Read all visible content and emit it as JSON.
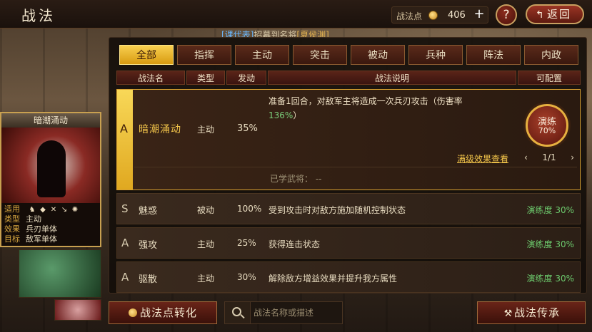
{
  "header": {
    "title": "战法",
    "points_label": "战法点",
    "points_value": "406",
    "plus": "+",
    "help": "?",
    "back_label": "返回"
  },
  "subheader": {
    "part1": "[课代表]",
    "part2": "招募到名将",
    "part3": "[夏侯渊]"
  },
  "tabs": [
    "全部",
    "指挥",
    "主动",
    "突击",
    "被动",
    "兵种",
    "阵法",
    "内政"
  ],
  "table_headers": [
    "战法名",
    "类型",
    "发动",
    "战法说明",
    "可配置"
  ],
  "expanded": {
    "grade": "A",
    "name": "暗潮涌动",
    "type": "主动",
    "rate": "35%",
    "desc_line1": "准备1回合，对敌军主将造成一次兵刃攻击（伤害率",
    "desc_pct": "136%",
    "desc_tail": "）",
    "badge_line1": "演练",
    "badge_line2": "70%",
    "max_link": "满级效果查看",
    "pager": "1/1",
    "learned": "已学武将：  --"
  },
  "rows": [
    {
      "grade": "S",
      "name": "魅惑",
      "type": "被动",
      "rate": "100%",
      "desc": "受到攻击时对敌方施加随机控制状态",
      "progress": "演练度 30%"
    },
    {
      "grade": "A",
      "name": "强攻",
      "type": "主动",
      "rate": "25%",
      "desc": "获得连击状态",
      "progress": "演练度 30%"
    },
    {
      "grade": "A",
      "name": "驱散",
      "type": "主动",
      "rate": "30%",
      "desc": "解除敌方增益效果并提升我方属性",
      "progress": "演练度 30%"
    }
  ],
  "card": {
    "title": "暗潮涌动",
    "k_apply": "适用",
    "k_type": "类型",
    "v_type": "主动",
    "k_effect": "效果",
    "v_effect": "兵刃单体",
    "k_target": "目标",
    "v_target": "敌军单体"
  },
  "bottom": {
    "convert_label": "战法点转化",
    "search_placeholder": "战法名称或描述",
    "inherit_label": "战法传承"
  },
  "colors": {
    "accent_gold": "#f2c44a",
    "progress_green": "#6cc86c",
    "active_tab": "#f8d050"
  }
}
